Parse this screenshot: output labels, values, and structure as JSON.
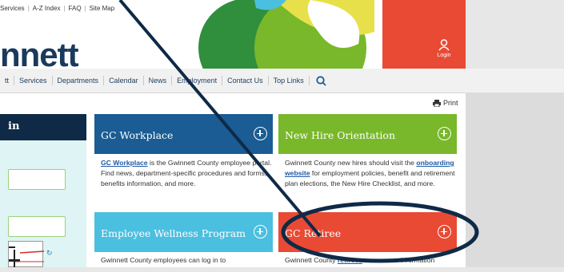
{
  "util_nav": [
    "Services",
    "A-Z Index",
    "FAQ",
    "Site Map"
  ],
  "brand": {
    "text": "nnett"
  },
  "login": {
    "label": "Login"
  },
  "main_nav": [
    "tt",
    "Services",
    "Departments",
    "Calendar",
    "News",
    "Employment",
    "Contact Us",
    "Top Links"
  ],
  "print": {
    "label": "Print"
  },
  "sidebar": {
    "title": "in"
  },
  "cards": [
    {
      "title": "GC Workplace",
      "color": "#1a5c93",
      "desc_link": "GC Workplace",
      "desc_after": " is the Gwinnett County employee portal. Find news, department-specific procedures and forms, benefits information, and more."
    },
    {
      "title": "New Hire Orientation",
      "color": "#78b82a",
      "desc_before": "Gwinnett County new hires should visit the ",
      "desc_link": "onboarding website",
      "desc_after": " for employment policies, benefit and retirement plan elections, the New Hire Checklist, and more."
    },
    {
      "title": "Employee Wellness Program",
      "color": "#4bbfe0",
      "desc_text": "Gwinnett County employees can log in to"
    },
    {
      "title": "GC Retiree",
      "color": "#e84a34",
      "desc_before": "Gwinnett County ",
      "desc_link": "retirees",
      "desc_after": " can access information"
    }
  ],
  "colors": {
    "navy": "#0e2a47",
    "banner_red": "#e84a34",
    "banner_green": "#78b82a",
    "banner_yellow": "#e8e04a",
    "banner_cyan": "#4bbfe0"
  }
}
